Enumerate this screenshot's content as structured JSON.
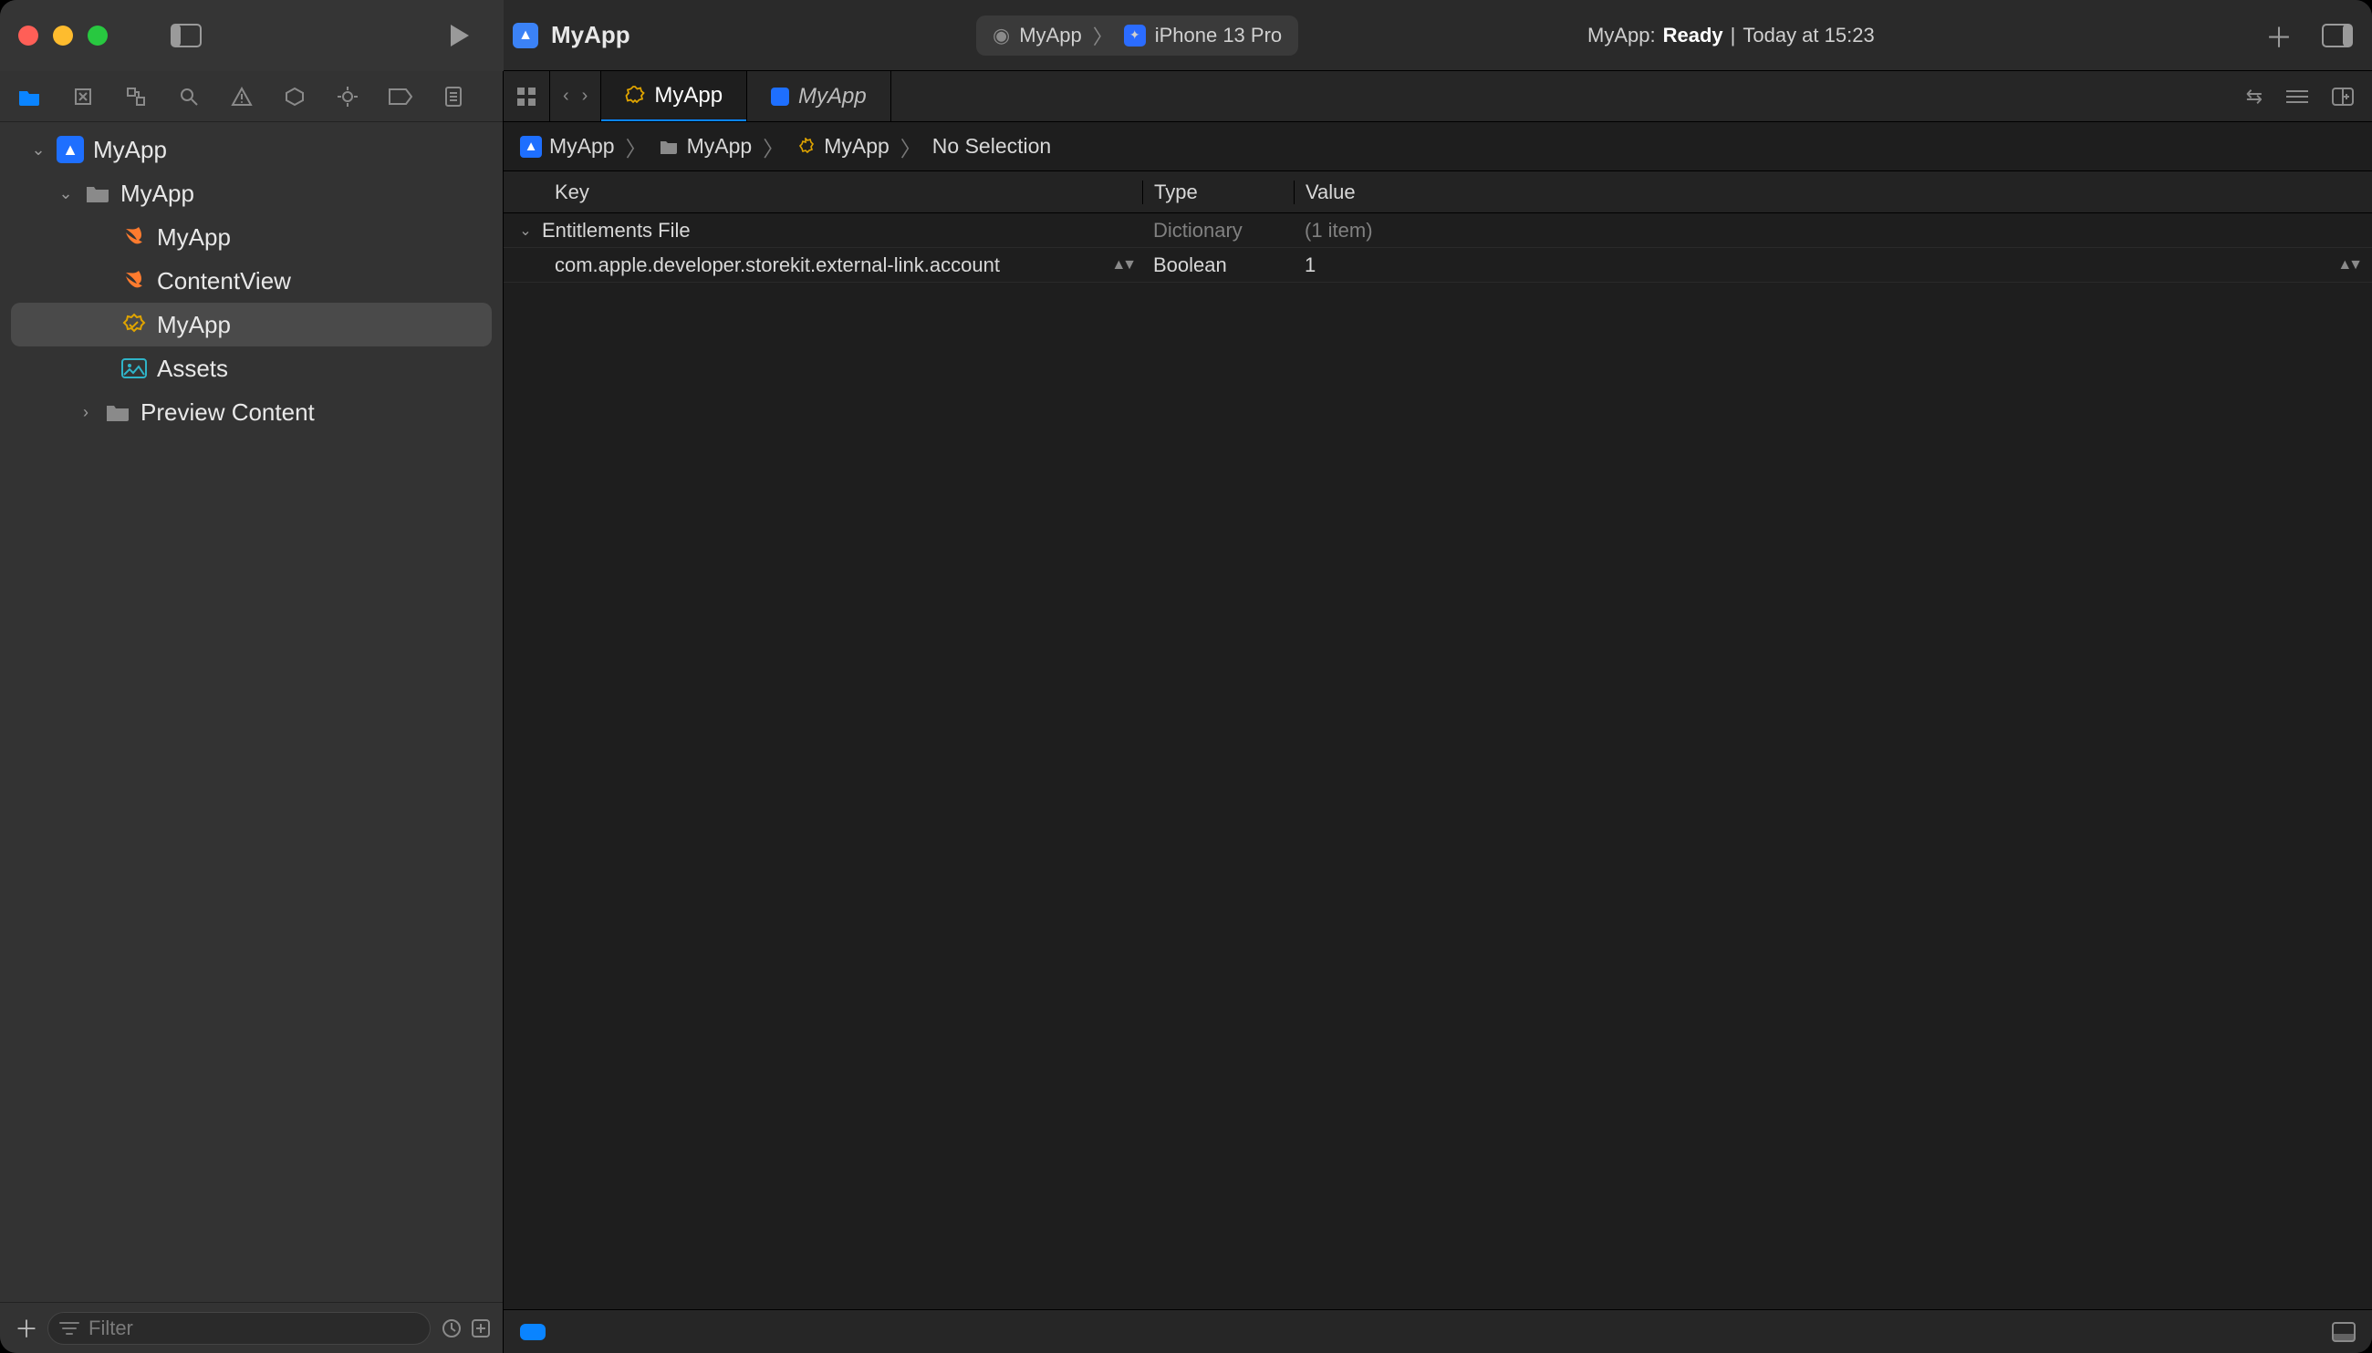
{
  "titlebar": {
    "app_name": "MyApp",
    "scheme_target": "MyApp",
    "scheme_device": "iPhone 13 Pro",
    "status_prefix": "MyApp:",
    "status_state": "Ready",
    "status_separator": "|",
    "status_time": "Today at 15:23"
  },
  "navigator": {
    "project_root": "MyApp",
    "group_folder": "MyApp",
    "files": {
      "swift_app": "MyApp",
      "swift_contentview": "ContentView",
      "entitlements": "MyApp",
      "assets": "Assets",
      "preview_content": "Preview Content"
    },
    "filter_placeholder": "Filter"
  },
  "tabs": {
    "active_label": "MyApp",
    "inactive_label": "MyApp"
  },
  "jumpbar": {
    "p1": "MyApp",
    "p2": "MyApp",
    "p3": "MyApp",
    "p4": "No Selection"
  },
  "plist": {
    "header_key": "Key",
    "header_type": "Type",
    "header_value": "Value",
    "root_key": "Entitlements File",
    "root_type": "Dictionary",
    "root_value": "(1 item)",
    "child_key": "com.apple.developer.storekit.external-link.account",
    "child_type": "Boolean",
    "child_value": "1"
  }
}
